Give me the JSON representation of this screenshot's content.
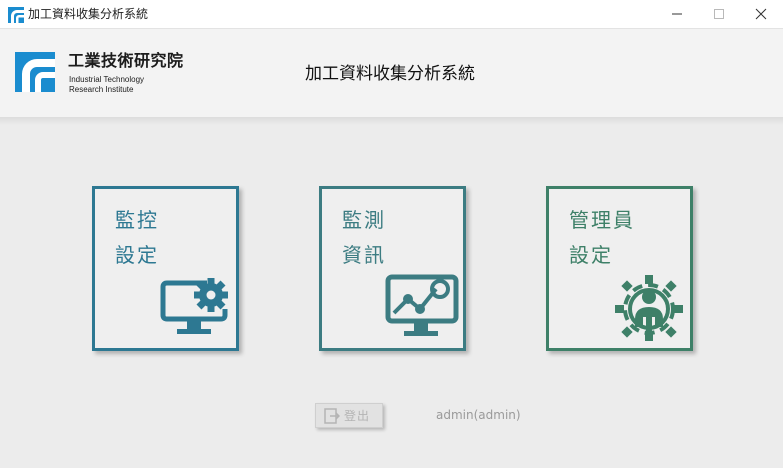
{
  "window": {
    "title": "加工資料收集分析系統",
    "icon": "itri-logo-icon",
    "controls": [
      "minimize-icon",
      "maximize-icon",
      "close-icon"
    ]
  },
  "header": {
    "logo_cn": "工業技術研究院",
    "logo_en_line1": "Industrial Technology",
    "logo_en_line2": "Research Institute",
    "title": "加工資料收集分析系統"
  },
  "tiles": [
    {
      "label": "監控\n設定",
      "icon": "monitor-gear-icon",
      "color": "#2d7892"
    },
    {
      "label": "監測\n資訊",
      "icon": "monitor-chart-icon",
      "color": "#3c7c82"
    },
    {
      "label": "管理員\n設定",
      "icon": "admin-gear-icon",
      "color": "#3e8068"
    }
  ],
  "footer": {
    "logout_label": "登出",
    "logout_icon": "logout-icon",
    "user_label": "admin(admin)"
  },
  "colors": {
    "brand_blue": "#1a8ccf",
    "background": "#ececec"
  }
}
